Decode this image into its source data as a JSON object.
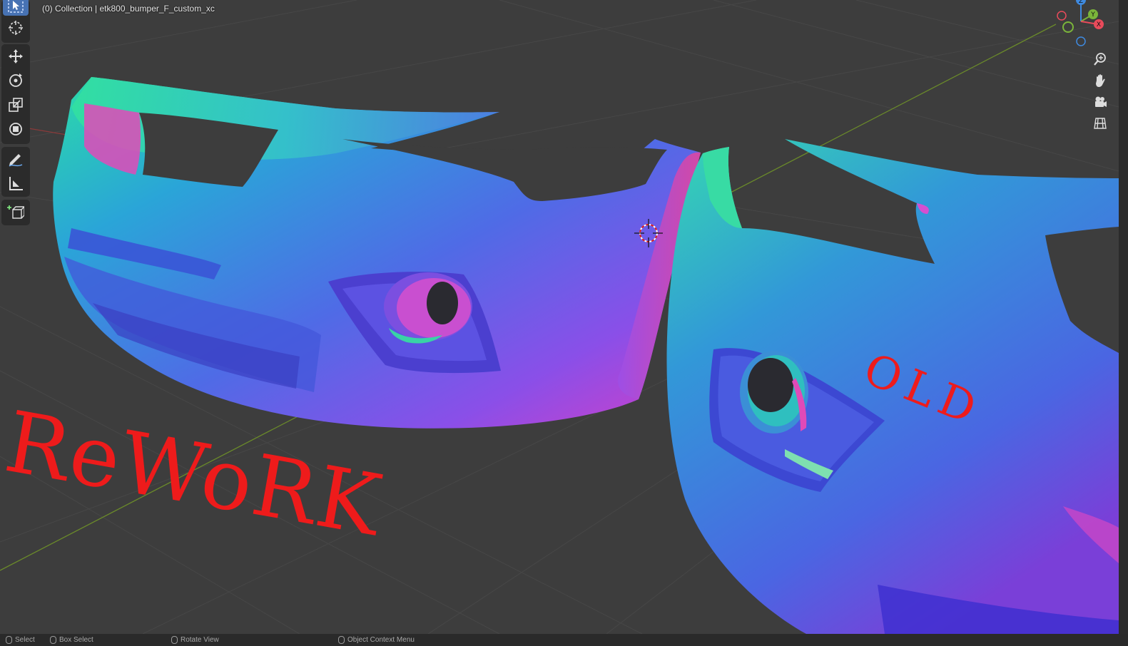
{
  "viewport": {
    "header_text": "(0) Collection | etk800_bumper_F_custom_xc"
  },
  "toolbar": {
    "tools": [
      {
        "name": "select-box-tool",
        "icon": "cursor-select-icon"
      },
      {
        "name": "cursor-tool",
        "icon": "3d-cursor-icon"
      },
      {
        "name": "move-tool",
        "icon": "move-arrows-icon"
      },
      {
        "name": "rotate-tool",
        "icon": "rotate-icon"
      },
      {
        "name": "scale-tool",
        "icon": "scale-icon"
      },
      {
        "name": "transform-tool",
        "icon": "transform-icon"
      },
      {
        "name": "annotate-tool",
        "icon": "annotate-pen-icon"
      },
      {
        "name": "measure-tool",
        "icon": "ruler-icon"
      },
      {
        "name": "add-cube-tool",
        "icon": "add-cube-icon"
      }
    ]
  },
  "gizmo": {
    "x_label": "X",
    "y_label": "Y",
    "z_label": "Z",
    "colors": {
      "x": "#e94b5b",
      "y": "#7bb53a",
      "z": "#3f8ae0"
    }
  },
  "nav_buttons": [
    {
      "name": "zoom-button",
      "icon": "zoom-magnifier-icon"
    },
    {
      "name": "pan-button",
      "icon": "hand-icon"
    },
    {
      "name": "camera-view-button",
      "icon": "camera-icon"
    },
    {
      "name": "perspective-toggle-button",
      "icon": "grid-icon"
    }
  ],
  "annotations": {
    "left": "ReWoRK",
    "right": "OLD",
    "color": "#ee1b1b"
  },
  "status_bar": {
    "items": [
      "Select",
      "Box Select",
      "Rotate View",
      "Object Context Menu"
    ]
  }
}
